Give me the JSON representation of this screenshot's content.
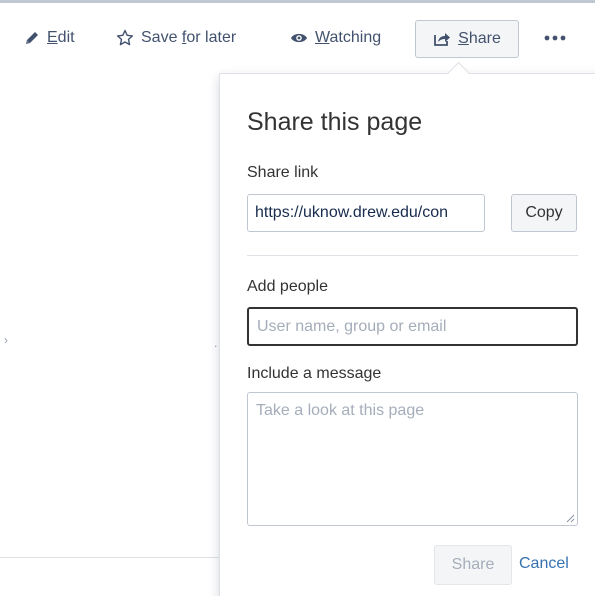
{
  "toolbar": {
    "edit": {
      "before": "",
      "under": "E",
      "after": "dit",
      "icon": "pencil-icon"
    },
    "save": {
      "before": "Save ",
      "under": "f",
      "after": "or later",
      "icon": "star-icon"
    },
    "watch": {
      "before": "",
      "under": "W",
      "after": "atching",
      "icon": "eye-icon"
    },
    "share": {
      "before": "",
      "under": "S",
      "after": "hare",
      "icon": "share-icon"
    },
    "more": {
      "label": "•••",
      "icon": "more-icon"
    }
  },
  "content": {
    "left_mark": "›",
    "mid_mark": "."
  },
  "share_dialog": {
    "title": "Share this page",
    "share_link_label": "Share link",
    "share_link_value": "https://uknow.drew.edu/con",
    "copy_label": "Copy",
    "add_people_label": "Add people",
    "add_people_placeholder": "User name, group or email",
    "message_label": "Include a message",
    "message_placeholder": "Take a look at this page",
    "share_button_label": "Share",
    "cancel_label": "Cancel"
  },
  "colors": {
    "text": "#333333",
    "toolbar_text": "#42526e",
    "link": "#3572b0",
    "border": "#c1c7d0",
    "button_bg": "#f4f5f7",
    "placeholder": "#a5adba"
  }
}
